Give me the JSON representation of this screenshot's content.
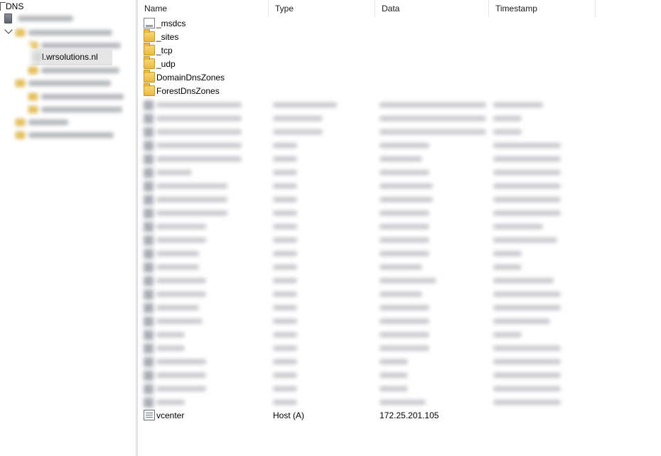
{
  "tree": {
    "root_label": "DNS",
    "selected_zone_label": "l.wrsolutions.nl",
    "icons": [
      "server-icon",
      "folder-icon"
    ]
  },
  "columns": {
    "name": "Name",
    "type": "Type",
    "data": "Data",
    "timestamp": "Timestamp"
  },
  "folders": [
    {
      "name": "_msdcs",
      "icon": "zone-doc-icon"
    },
    {
      "name": "_sites",
      "icon": "folder-icon"
    },
    {
      "name": "_tcp",
      "icon": "folder-icon"
    },
    {
      "name": "_udp",
      "icon": "folder-icon"
    },
    {
      "name": "DomainDnsZones",
      "icon": "folder-icon"
    },
    {
      "name": "ForestDnsZones",
      "icon": "folder-icon"
    }
  ],
  "visible_record": {
    "name": "vcenter",
    "type": "Host (A)",
    "data": "172.25.201.105",
    "timestamp": ""
  },
  "colors": {
    "selection": "#e5e5e5",
    "folder": "#e9b940",
    "header_border": "#e5e5e5"
  }
}
